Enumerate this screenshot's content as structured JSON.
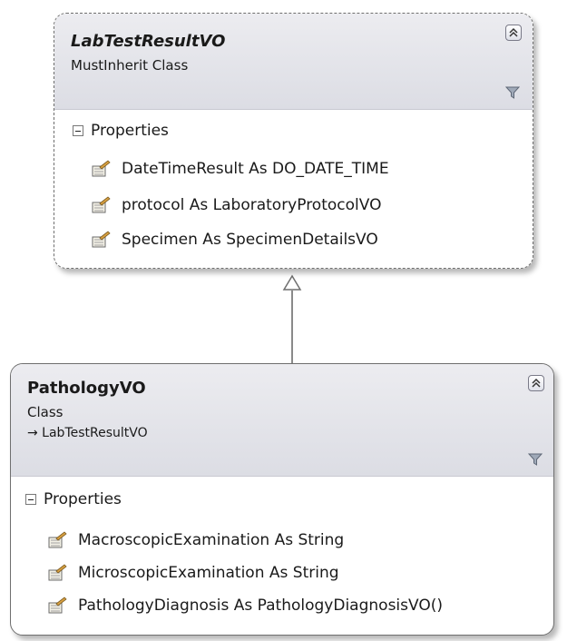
{
  "classes": [
    {
      "name": "LabTestResultVO",
      "stereotype": "MustInherit Class",
      "section": "Properties",
      "properties": [
        "DateTimeResult As DO_DATE_TIME",
        "protocol As LaboratoryProtocolVO",
        "Specimen As SpecimenDetailsVO"
      ]
    },
    {
      "name": "PathologyVO",
      "stereotype": "Class",
      "base": "→ LabTestResultVO",
      "section": "Properties",
      "properties": [
        "MacroscopicExamination As String",
        "MicroscopicExamination As String",
        "PathologyDiagnosis As PathologyDiagnosisVO()"
      ]
    }
  ],
  "icons": {
    "collapse": "double-chevron-up-icon",
    "filter": "filter-funnel-icon",
    "property": "property-wrench-icon",
    "section_toggle": "minus-box-icon"
  }
}
